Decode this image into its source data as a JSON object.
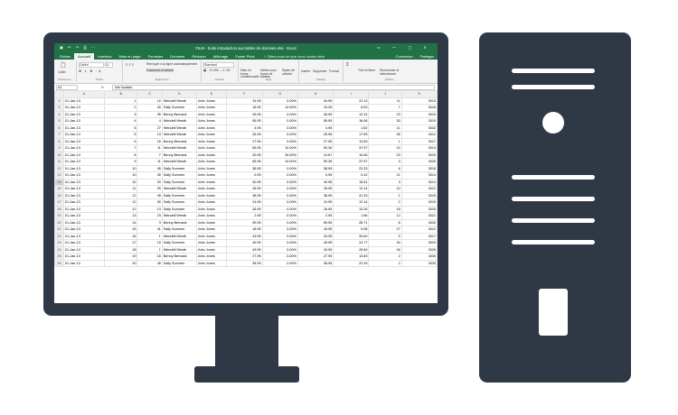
{
  "window": {
    "title": "FILM - Suite introduction aux tables de données.xlsx - Excel",
    "quick_access": "▣ ↶ ↷ ⎙ ⋯",
    "controls": "▭ — ▢ ✕"
  },
  "ribbon_tabs": [
    "Fichier",
    "Accueil",
    "Insertion",
    "Mise en page",
    "Formules",
    "Données",
    "Révision",
    "Affichage",
    "Power Pivot"
  ],
  "help_text": "♀ Dites-nous ce que vous voulez faire",
  "account": {
    "connect": "Connexion",
    "share": "Partager"
  },
  "ribbon": {
    "paste": "Coller",
    "font_name": "Calibri",
    "font_size": "11",
    "wrap": "Renvoyer à la ligne automatiquement",
    "merge": "Fusionner et centrer",
    "number_format": "Standard",
    "cond_format": "Mise en forme conditionnelle",
    "format_table": "Mettre sous forme de tableau",
    "cell_styles": "Styles de cellules",
    "insert": "Insérer",
    "delete": "Supprimer",
    "format": "Format",
    "sort": "Trier et filtrer",
    "find": "Rechercher et sélectionner",
    "groups": [
      "Presse-pa...",
      "Police",
      "Alignement",
      "Nombre",
      "Style",
      "Cellules",
      "Édition"
    ]
  },
  "formula_bar": {
    "cell": "A1",
    "fx": "fx",
    "value": "Info location"
  },
  "selected_row": "14",
  "columns": [
    "A",
    "B",
    "C",
    "D",
    "E",
    "F",
    "G",
    "H",
    "I",
    "J",
    "K"
  ],
  "rows": [
    {
      "n": "2",
      "a": "01-Jan-13",
      "b": "1",
      "c": "10",
      "d": "Wendell Westb",
      "e": "John Jones",
      "f": "34.95",
      "g": "0.00%",
      "h": "34.95",
      "i": "22.13",
      "j": "11",
      "k": "3013"
    },
    {
      "n": "3",
      "a": "01-Jan-13",
      "b": "2",
      "c": "40",
      "d": "Sally Summer",
      "e": "John Jones",
      "f": "16.95",
      "g": "10.00%",
      "h": "15.26",
      "i": "6.53",
      "j": "7",
      "k": "3018"
    },
    {
      "n": "4",
      "a": "01-Jan-13",
      "b": "3",
      "c": "35",
      "d": "Benny Bernank",
      "e": "John Jones",
      "f": "26.95",
      "g": "0.00%",
      "h": "26.95",
      "i": "12.24",
      "j": "23",
      "k": "3010"
    },
    {
      "n": "5",
      "a": "01-Jan-13",
      "b": "4",
      "c": "4",
      "d": "Wendell Westb",
      "e": "John Jones",
      "f": "55.95",
      "g": "0.00%",
      "h": "55.95",
      "i": "16.06",
      "j": "30",
      "k": "3019"
    },
    {
      "n": "6",
      "a": "01-Jan-13",
      "b": "5",
      "c": "27",
      "d": "Wendell Westb",
      "e": "John Jones",
      "f": "4.95",
      "g": "0.00%",
      "h": "4.95",
      "i": "1.82",
      "j": "11",
      "k": "3032"
    },
    {
      "n": "7",
      "a": "01-Jan-13",
      "b": "5",
      "c": "13",
      "d": "Wendell Westb",
      "e": "John Jones",
      "f": "26.95",
      "g": "0.00%",
      "h": "26.95",
      "i": "17.53",
      "j": "35",
      "k": "3012"
    },
    {
      "n": "8",
      "a": "01-Jan-13",
      "b": "6",
      "c": "16",
      "d": "Benny Bernank",
      "e": "John Jones",
      "f": "27.95",
      "g": "0.00%",
      "h": "27.95",
      "i": "13.83",
      "j": "1",
      "k": "3017"
    },
    {
      "n": "9",
      "a": "01-Jan-13",
      "b": "7",
      "c": "11",
      "d": "Wendell Westb",
      "e": "John Jones",
      "f": "65.95",
      "g": "10.00%",
      "h": "59.36",
      "i": "37.97",
      "j": "10",
      "k": "3013"
    },
    {
      "n": "10",
      "a": "01-Jan-13",
      "b": "8",
      "c": "7",
      "d": "Benny Bernank",
      "e": "John Jones",
      "f": "20.95",
      "g": "30.00%",
      "h": "14.67",
      "i": "10.06",
      "j": "23",
      "k": "3020"
    },
    {
      "n": "11",
      "a": "01-Jan-13",
      "b": "9",
      "c": "11",
      "d": "Wendell Westb",
      "e": "John Jones",
      "f": "65.95",
      "g": "10.00%",
      "h": "59.36",
      "i": "37.97",
      "j": "3",
      "k": "3025"
    },
    {
      "n": "12",
      "a": "01-Jan-13",
      "b": "10",
      "c": "45",
      "d": "Sally Summer",
      "e": "John Jones",
      "f": "38.95",
      "g": "0.00%",
      "h": "38.95",
      "i": "22.33",
      "j": "6",
      "k": "3018"
    },
    {
      "n": "13",
      "a": "01-Jan-13",
      "b": "10",
      "c": "26",
      "d": "Sally Summer",
      "e": "John Jones",
      "f": "0.95",
      "g": "0.00%",
      "h": "0.95",
      "i": "0.42",
      "j": "11",
      "k": "3014"
    },
    {
      "n": "14",
      "a": "01-Jan-13",
      "b": "10",
      "c": "29",
      "d": "Sally Summer",
      "e": "John Jones",
      "f": "40.95",
      "g": "0.00%",
      "h": "40.95",
      "i": "15.51",
      "j": "3",
      "k": "3014"
    },
    {
      "n": "15",
      "a": "01-Jan-13",
      "b": "11",
      "c": "39",
      "d": "Wendell Westb",
      "e": "John Jones",
      "f": "26.95",
      "g": "0.00%",
      "h": "26.95",
      "i": "12.24",
      "j": "10",
      "k": "3012"
    },
    {
      "n": "16",
      "a": "01-Jan-13",
      "b": "12",
      "c": "45",
      "d": "Sally Summer",
      "e": "John Jones",
      "f": "38.95",
      "g": "0.00%",
      "h": "38.95",
      "i": "22.33",
      "j": "1",
      "k": "3015"
    },
    {
      "n": "17",
      "a": "01-Jan-13",
      "b": "12",
      "c": "30",
      "d": "Sally Summer",
      "e": "John Jones",
      "f": "24.95",
      "g": "0.00%",
      "h": "24.95",
      "i": "12.14",
      "j": "2",
      "k": "3015"
    },
    {
      "n": "18",
      "a": "01-Jan-13",
      "b": "12",
      "c": "13",
      "d": "Sally Summer",
      "e": "John Jones",
      "f": "26.95",
      "g": "0.00%",
      "h": "26.95",
      "i": "13.26",
      "j": "18",
      "k": "3015"
    },
    {
      "n": "19",
      "a": "01-Jan-13",
      "b": "13",
      "c": "23",
      "d": "Wendell Westb",
      "e": "John Jones",
      "f": "2.95",
      "g": "0.00%",
      "h": "2.95",
      "i": "1.66",
      "j": "12",
      "k": "3021"
    },
    {
      "n": "20",
      "a": "01-Jan-13",
      "b": "14",
      "c": "3",
      "d": "Benny Bernank",
      "e": "John Jones",
      "f": "59.95",
      "g": "0.00%",
      "h": "59.95",
      "i": "28.71",
      "j": "6",
      "k": "3020"
    },
    {
      "n": "21",
      "a": "01-Jan-13",
      "b": "15",
      "c": "41",
      "d": "Sally Summer",
      "e": "John Jones",
      "f": "18.95",
      "g": "0.00%",
      "h": "18.95",
      "i": "9.98",
      "j": "27",
      "k": "3012"
    },
    {
      "n": "22",
      "a": "01-Jan-13",
      "b": "16",
      "c": "1",
      "d": "Wendell Westb",
      "e": "John Jones",
      "f": "43.95",
      "g": "0.00%",
      "h": "43.95",
      "i": "25.60",
      "j": "5",
      "k": "3017"
    },
    {
      "n": "23",
      "a": "01-Jan-13",
      "b": "17",
      "c": "19",
      "d": "Sally Summer",
      "e": "John Jones",
      "f": "49.95",
      "g": "0.00%",
      "h": "49.95",
      "i": "24.77",
      "j": "34",
      "k": "3023"
    },
    {
      "n": "24",
      "a": "01-Jan-13",
      "b": "18",
      "c": "1",
      "d": "Wendell Westb",
      "e": "John Jones",
      "f": "43.95",
      "g": "0.00%",
      "h": "43.95",
      "i": "25.60",
      "j": "16",
      "k": "3028"
    },
    {
      "n": "25",
      "a": "01-Jan-13",
      "b": "19",
      "c": "16",
      "d": "Benny Bernank",
      "e": "John Jones",
      "f": "27.95",
      "g": "0.00%",
      "h": "27.95",
      "i": "13.83",
      "j": "2",
      "k": "3030"
    },
    {
      "n": "26",
      "a": "01-Jan-13",
      "b": "20",
      "c": "45",
      "d": "Sally Summer",
      "e": "John Jones",
      "f": "38.95",
      "g": "0.00%",
      "h": "38.95",
      "i": "22.33",
      "j": "2",
      "k": "3033"
    }
  ],
  "colors": {
    "excel_green": "#217346",
    "device": "#2f3946"
  }
}
